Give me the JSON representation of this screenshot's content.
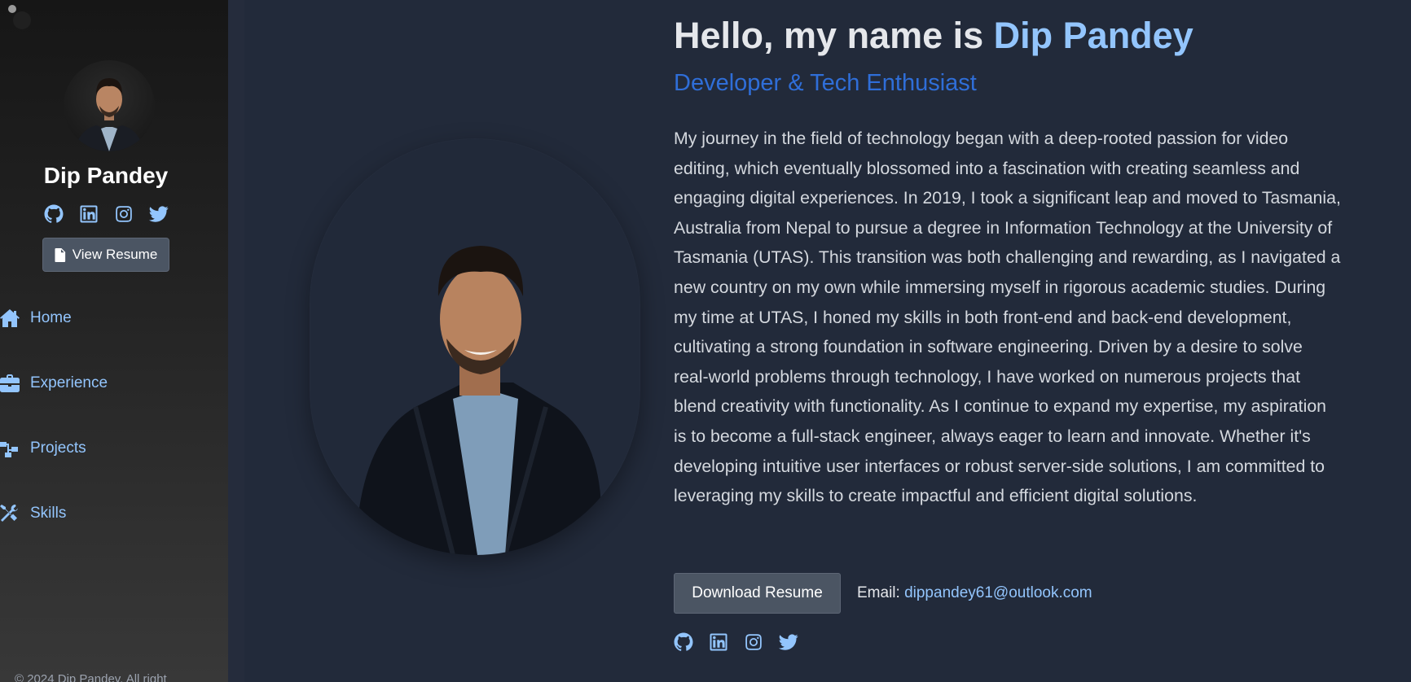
{
  "sidebar": {
    "name": "Dip Pandey",
    "social": [
      "github-icon",
      "linkedin-icon",
      "instagram-icon",
      "twitter-icon"
    ],
    "resume_button": "View Resume",
    "nav": [
      {
        "label": "Home",
        "icon": "home-icon"
      },
      {
        "label": "Experience",
        "icon": "briefcase-icon"
      },
      {
        "label": "Projects",
        "icon": "project-diagram-icon"
      },
      {
        "label": "Skills",
        "icon": "tools-icon"
      }
    ],
    "footer": "© 2024 Dip Pandey. All right"
  },
  "main": {
    "greeting": "Hello, my name is ",
    "name": "Dip Pandey",
    "subtitle": "Developer & Tech Enthusiast",
    "bio": "My journey in the field of technology began with a deep-rooted passion for video editing, which eventually blossomed into a fascination with creating seamless and engaging digital experiences. In 2019, I took a significant leap and moved to Tasmania, Australia from Nepal to pursue a degree in Information Technology at the University of Tasmania (UTAS). This transition was both challenging and rewarding, as I navigated a new country on my own while immersing myself in rigorous academic studies. During my time at UTAS, I honed my skills in both front-end and back-end development, cultivating a strong foundation in software engineering. Driven by a desire to solve real-world problems through technology, I have worked on numerous projects that blend creativity with functionality. As I continue to expand my expertise, my aspiration is to become a full-stack engineer, always eager to learn and innovate. Whether it's developing intuitive user interfaces or robust server-side solutions, I am committed to leveraging my skills to create impactful and efficient digital solutions.",
    "download_button": "Download Resume",
    "email_label": "Email: ",
    "email": "dippandey61@outlook.com",
    "social": [
      "github-icon",
      "linkedin-icon",
      "instagram-icon",
      "twitter-icon"
    ]
  },
  "colors": {
    "background": "#222a3a",
    "accent": "#93c5fd",
    "subtitle": "#2f6ed8",
    "button": "#4b5563"
  }
}
